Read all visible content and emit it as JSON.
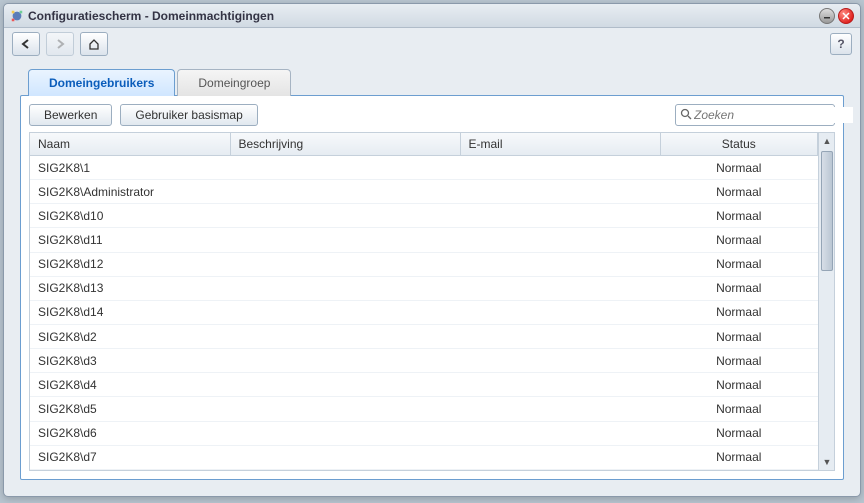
{
  "window": {
    "title": "Configuratiescherm - Domeinmachtigingen"
  },
  "nav": {
    "help": "?"
  },
  "tabs": [
    {
      "label": "Domeingebruikers",
      "active": true
    },
    {
      "label": "Domeingroep",
      "active": false
    }
  ],
  "toolbar": {
    "edit": "Bewerken",
    "userhome": "Gebruiker basismap"
  },
  "search": {
    "placeholder": "Zoeken"
  },
  "columns": {
    "name": "Naam",
    "desc": "Beschrijving",
    "email": "E-mail",
    "status": "Status"
  },
  "rows": [
    {
      "name": "SIG2K8\\1",
      "desc": "",
      "email": "",
      "status": "Normaal"
    },
    {
      "name": "SIG2K8\\Administrator",
      "desc": "",
      "email": "",
      "status": "Normaal"
    },
    {
      "name": "SIG2K8\\d10",
      "desc": "",
      "email": "",
      "status": "Normaal"
    },
    {
      "name": "SIG2K8\\d11",
      "desc": "",
      "email": "",
      "status": "Normaal"
    },
    {
      "name": "SIG2K8\\d12",
      "desc": "",
      "email": "",
      "status": "Normaal"
    },
    {
      "name": "SIG2K8\\d13",
      "desc": "",
      "email": "",
      "status": "Normaal"
    },
    {
      "name": "SIG2K8\\d14",
      "desc": "",
      "email": "",
      "status": "Normaal"
    },
    {
      "name": "SIG2K8\\d2",
      "desc": "",
      "email": "",
      "status": "Normaal"
    },
    {
      "name": "SIG2K8\\d3",
      "desc": "",
      "email": "",
      "status": "Normaal"
    },
    {
      "name": "SIG2K8\\d4",
      "desc": "",
      "email": "",
      "status": "Normaal"
    },
    {
      "name": "SIG2K8\\d5",
      "desc": "",
      "email": "",
      "status": "Normaal"
    },
    {
      "name": "SIG2K8\\d6",
      "desc": "",
      "email": "",
      "status": "Normaal"
    },
    {
      "name": "SIG2K8\\d7",
      "desc": "",
      "email": "",
      "status": "Normaal"
    }
  ]
}
